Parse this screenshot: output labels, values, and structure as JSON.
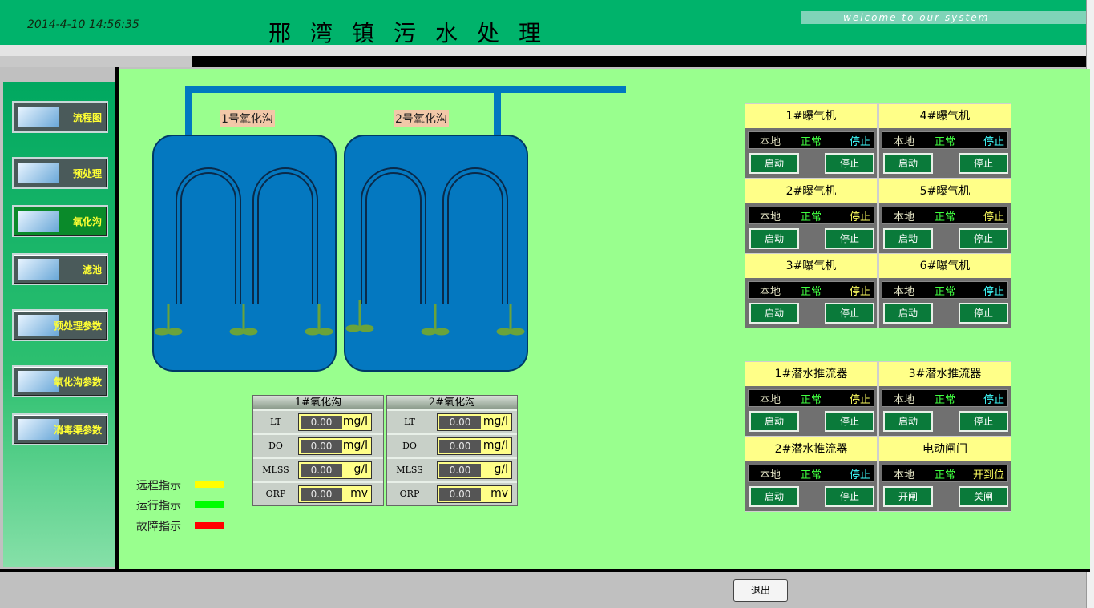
{
  "header": {
    "datetime": "2014-4-10 14:56:35",
    "title": "邢湾镇污水处理",
    "welcome": "welcome to our system"
  },
  "sidebar": {
    "items": [
      {
        "label": "流程图"
      },
      {
        "label": "预处理"
      },
      {
        "label": "氧化沟"
      },
      {
        "label": "滤池"
      },
      {
        "label": "预处理参数"
      },
      {
        "label": "氧化沟参数"
      },
      {
        "label": "消毒渠参数"
      }
    ]
  },
  "tanks": {
    "tank1_label": "1号氧化沟",
    "tank2_label": "2号氧化沟"
  },
  "sensors": [
    {
      "title": "1#氧化沟",
      "rows": [
        {
          "key": "LT",
          "value": "0.00",
          "unit": "mg/l"
        },
        {
          "key": "DO",
          "value": "0.00",
          "unit": "mg/l"
        },
        {
          "key": "MLSS",
          "value": "0.00",
          "unit": "g/l"
        },
        {
          "key": "ORP",
          "value": "0.00",
          "unit": "mv"
        }
      ]
    },
    {
      "title": "2#氧化沟",
      "rows": [
        {
          "key": "LT",
          "value": "0.00",
          "unit": "mg/l"
        },
        {
          "key": "DO",
          "value": "0.00",
          "unit": "mg/l"
        },
        {
          "key": "MLSS",
          "value": "0.00",
          "unit": "g/l"
        },
        {
          "key": "ORP",
          "value": "0.00",
          "unit": "mv"
        }
      ]
    }
  ],
  "legend": [
    {
      "label": "远程指示",
      "color": "#ffff00"
    },
    {
      "label": "运行指示",
      "color": "#00ff00"
    },
    {
      "label": "故障指示",
      "color": "#ff0000"
    }
  ],
  "aerators": [
    {
      "name": "1#曝气机",
      "mode": "本地",
      "state": "正常",
      "run": "停止",
      "btn_start": "启动",
      "btn_stop": "停止"
    },
    {
      "name": "4#曝气机",
      "mode": "本地",
      "state": "正常",
      "run": "停止",
      "btn_start": "启动",
      "btn_stop": "停止"
    },
    {
      "name": "2#曝气机",
      "mode": "本地",
      "state": "正常",
      "run": "停止",
      "btn_start": "启动",
      "btn_stop": "停止"
    },
    {
      "name": "5#曝气机",
      "mode": "本地",
      "state": "正常",
      "run": "停止",
      "btn_start": "启动",
      "btn_stop": "停止"
    },
    {
      "name": "3#曝气机",
      "mode": "本地",
      "state": "正常",
      "run": "停止",
      "btn_start": "启动",
      "btn_stop": "停止"
    },
    {
      "name": "6#曝气机",
      "mode": "本地",
      "state": "正常",
      "run": "停止",
      "btn_start": "启动",
      "btn_stop": "停止"
    }
  ],
  "pushers": [
    {
      "name": "1#潜水推流器",
      "mode": "本地",
      "state": "正常",
      "run": "停止",
      "btn_start": "启动",
      "btn_stop": "停止"
    },
    {
      "name": "3#潜水推流器",
      "mode": "本地",
      "state": "正常",
      "run": "停止",
      "btn_start": "启动",
      "btn_stop": "停止"
    },
    {
      "name": "2#潜水推流器",
      "mode": "本地",
      "state": "正常",
      "run": "停止",
      "btn_start": "启动",
      "btn_stop": "停止"
    },
    {
      "name": "电动闸门",
      "mode": "本地",
      "state": "正常",
      "run": "开到位",
      "btn_start": "开闸",
      "btn_stop": "关闸"
    }
  ],
  "footer": {
    "exit_label": "退出"
  }
}
